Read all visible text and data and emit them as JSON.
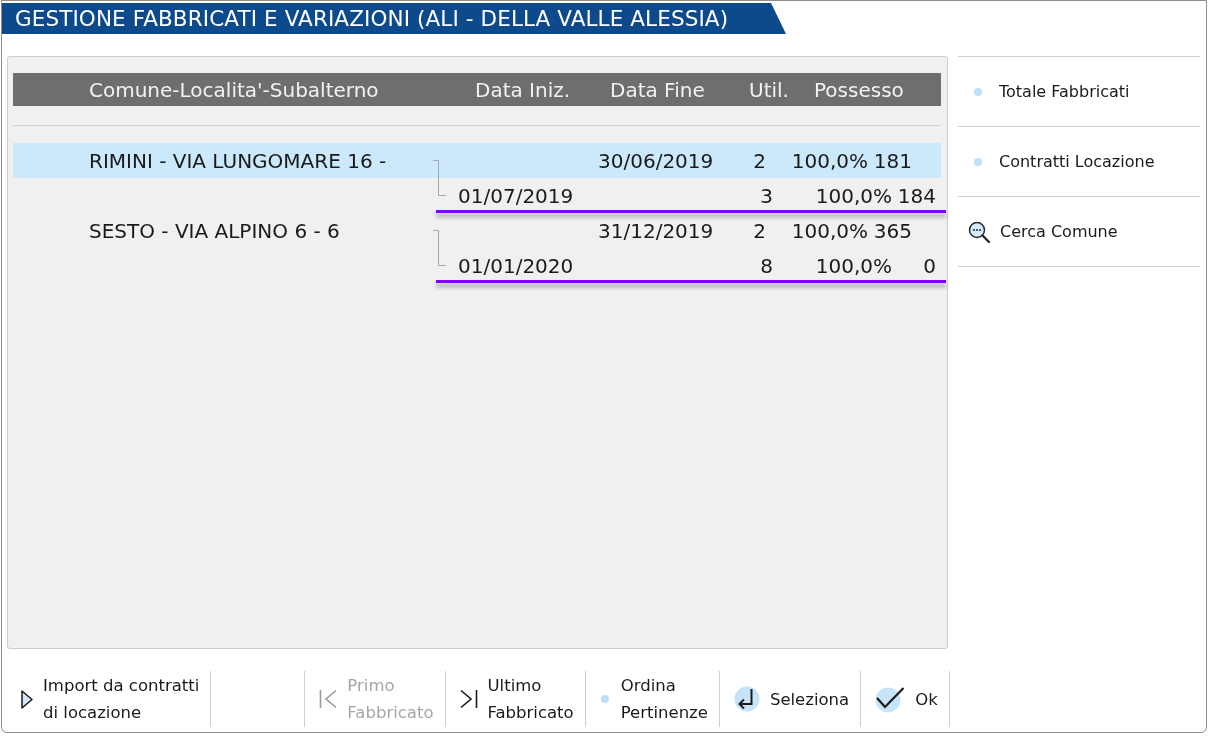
{
  "window": {
    "title": "GESTIONE FABBRICATI E VARIAZIONI (ALI - DELLA VALLE ALESSIA)"
  },
  "table": {
    "columns": [
      "Comune-Localita'-Subalterno",
      "Data Iniz.",
      "Data Fine",
      "Util.",
      "Possesso"
    ],
    "fabbricati": [
      {
        "comune": "RIMINI - VIA LUNGOMARE 16 -",
        "data_fine": "30/06/2019",
        "util": "2",
        "possesso": "100,0%",
        "column_6": "181",
        "selected": true,
        "children": [
          {
            "data_iniz": "01/07/2019",
            "util": "3",
            "possesso": "100,0%",
            "column_6": "184",
            "underlined": true
          }
        ]
      },
      {
        "comune": "SESTO - VIA ALPINO 6 - 6",
        "data_fine": "31/12/2019",
        "util": "2",
        "possesso": "100,0%",
        "column_6": "365",
        "selected": false,
        "children": [
          {
            "data_iniz": "01/01/2020",
            "util": "8",
            "possesso": "100,0%",
            "column_6": "0",
            "underlined": true
          }
        ]
      }
    ]
  },
  "sidebar": {
    "items": [
      {
        "label": "Totale Fabbricati",
        "kind": "dot"
      },
      {
        "label": "Contratti Locazione",
        "kind": "dot"
      },
      {
        "label": "Cerca Comune",
        "kind": "search"
      }
    ]
  },
  "toolbar": {
    "buttons": [
      {
        "lines": [
          "Import da contratti",
          "di locazione"
        ],
        "kind": "play",
        "disabled": false
      },
      {
        "lines": [
          "Primo",
          "Fabbricato"
        ],
        "kind": "first",
        "disabled": true
      },
      {
        "lines": [
          "Ultimo",
          "Fabbricato"
        ],
        "kind": "last",
        "disabled": false
      },
      {
        "lines": [
          "Ordina",
          "Pertinenze"
        ],
        "kind": "dot",
        "disabled": false
      },
      {
        "lines": [
          "Seleziona"
        ],
        "kind": "return",
        "disabled": false
      },
      {
        "lines": [
          "Ok"
        ],
        "kind": "check",
        "disabled": false
      }
    ]
  }
}
